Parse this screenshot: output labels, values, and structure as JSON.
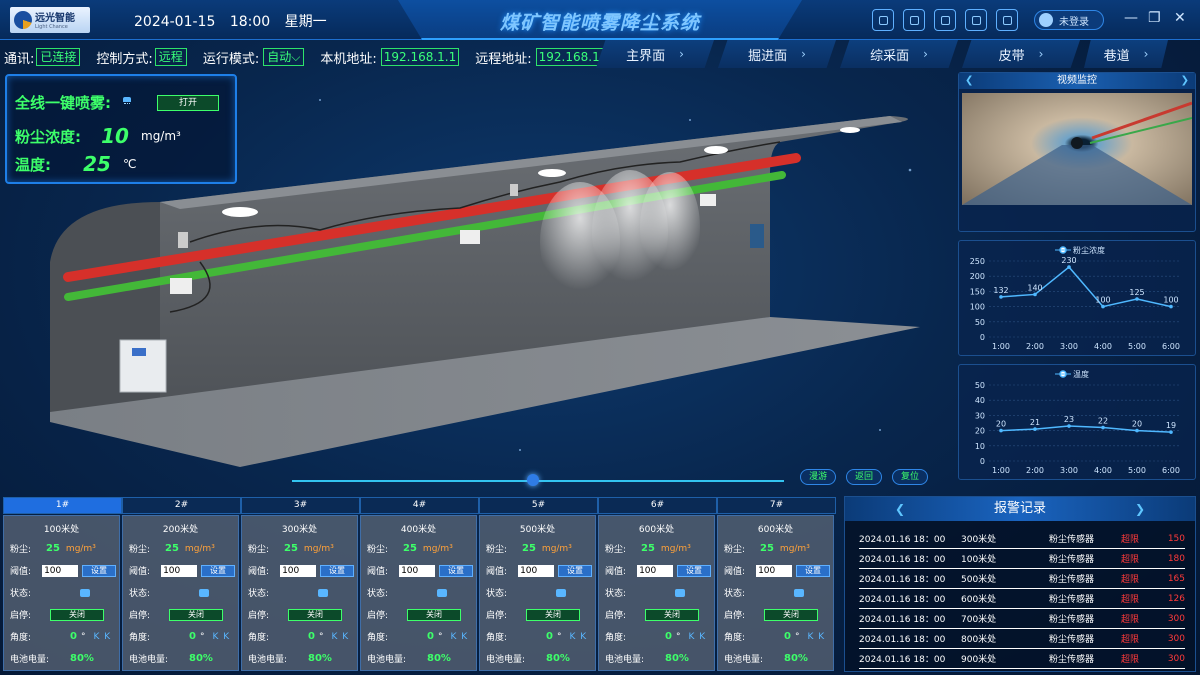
{
  "header": {
    "logo_text": "远光智能",
    "logo_sub": "Light Chance",
    "date": "2024-01-15",
    "time": "18:00",
    "weekday": "星期一",
    "title": "煤矿智能喷雾降尘系统",
    "login_text": "未登录"
  },
  "infobar": {
    "comm_label": "通讯:",
    "comm_value": "已连接",
    "ctrl_label": "控制方式:",
    "ctrl_value": "远程",
    "mode_label": "运行模式:",
    "mode_value": "自动",
    "local_label": "本机地址:",
    "local_ip": "192.168.1.1",
    "remote_label": "远程地址:",
    "remote_ip": "192.168.1.2"
  },
  "nav_tabs": [
    "主界面",
    "掘进面",
    "综采面",
    "皮带",
    "巷道"
  ],
  "top_panel": {
    "spray_label": "全线一键喷雾:",
    "open_button": "打开",
    "dust_label": "粉尘浓度:",
    "dust_value": "10",
    "dust_unit": "mg/m³",
    "temp_label": "温度:",
    "temp_value": "25",
    "temp_unit": "℃"
  },
  "scene_buttons": [
    "漫游",
    "返回",
    "复位"
  ],
  "slider_value": 0.49,
  "video": {
    "title": "视频监控"
  },
  "chart_data": [
    {
      "type": "line",
      "title": "粉尘浓度",
      "categories": [
        "1:00",
        "2:00",
        "3:00",
        "4:00",
        "5:00",
        "6:00"
      ],
      "values": [
        132,
        140,
        230,
        100,
        125,
        100
      ],
      "ylim": [
        0,
        250
      ],
      "yticks": [
        0,
        50,
        100,
        150,
        200,
        250
      ],
      "grid": true,
      "color": "#4fb8ff"
    },
    {
      "type": "line",
      "title": "温度",
      "categories": [
        "1:00",
        "2:00",
        "3:00",
        "4:00",
        "5:00",
        "6:00"
      ],
      "values": [
        20,
        21,
        23,
        22,
        20,
        19
      ],
      "ylim": [
        0,
        50
      ],
      "yticks": [
        0,
        10,
        20,
        30,
        40,
        50
      ],
      "grid": true,
      "color": "#4fb8ff"
    }
  ],
  "sensor_tabs": [
    "1#",
    "2#",
    "3#",
    "4#",
    "5#",
    "6#",
    "7#"
  ],
  "sensor_labels": {
    "dust": "粉尘:",
    "dust_unit": "mg/m³",
    "threshold": "阈值:",
    "set_button": "设置",
    "state": "状态:",
    "start_stop": "启停:",
    "toggle_label": "关闭",
    "angle": "角度:",
    "angle_unit": "°",
    "battery": "电池电量:"
  },
  "sensors": [
    {
      "position": "100米处",
      "dust": "25",
      "threshold": "100",
      "angle": "0",
      "battery": "80%"
    },
    {
      "position": "200米处",
      "dust": "25",
      "threshold": "100",
      "angle": "0",
      "battery": "80%"
    },
    {
      "position": "300米处",
      "dust": "25",
      "threshold": "100",
      "angle": "0",
      "battery": "80%"
    },
    {
      "position": "400米处",
      "dust": "25",
      "threshold": "100",
      "angle": "0",
      "battery": "80%"
    },
    {
      "position": "500米处",
      "dust": "25",
      "threshold": "100",
      "angle": "0",
      "battery": "80%"
    },
    {
      "position": "600米处",
      "dust": "25",
      "threshold": "100",
      "angle": "0",
      "battery": "80%"
    },
    {
      "position": "600米处",
      "dust": "25",
      "threshold": "100",
      "angle": "0",
      "battery": "80%"
    }
  ],
  "alarm": {
    "title": "报警记录",
    "rows": [
      {
        "time": "2024.01.16 18：00",
        "position": "300米处",
        "sensor": "粉尘传感器",
        "status": "超限",
        "value": "150"
      },
      {
        "time": "2024.01.16 18：00",
        "position": "100米处",
        "sensor": "粉尘传感器",
        "status": "超限",
        "value": "180"
      },
      {
        "time": "2024.01.16 18：00",
        "position": "500米处",
        "sensor": "粉尘传感器",
        "status": "超限",
        "value": "165"
      },
      {
        "time": "2024.01.16 18：00",
        "position": "600米处",
        "sensor": "粉尘传感器",
        "status": "超限",
        "value": "126"
      },
      {
        "time": "2024.01.16 18：00",
        "position": "700米处",
        "sensor": "粉尘传感器",
        "status": "超限",
        "value": "300"
      },
      {
        "time": "2024.01.16 18：00",
        "position": "800米处",
        "sensor": "粉尘传感器",
        "status": "超限",
        "value": "300"
      },
      {
        "time": "2024.01.16 18：00",
        "position": "900米处",
        "sensor": "粉尘传感器",
        "status": "超限",
        "value": "300"
      }
    ]
  }
}
